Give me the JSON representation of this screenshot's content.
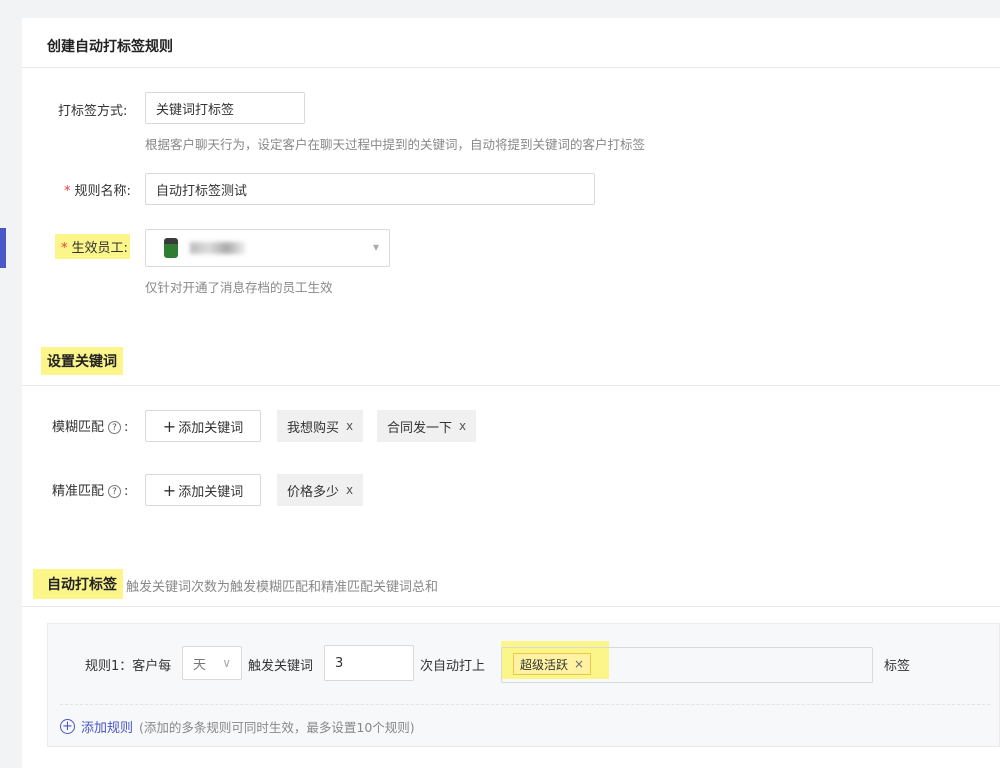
{
  "header": {
    "title": "创建自动打标签规则"
  },
  "form": {
    "method_label": "打标签方式:",
    "method_value": "关键词打标签",
    "method_hint": "根据客户聊天行为，设定客户在聊天过程中提到的关键词，自动将提到关键词的客户打标签",
    "rule_name_label": "规则名称:",
    "rule_name_value": "自动打标签测试",
    "employee_label": "生效员工:",
    "employee_hint": "仅针对开通了消息存档的员工生效",
    "required_mark": "*"
  },
  "keywords": {
    "section_title": "设置关键词",
    "fuzzy_label": "模糊匹配",
    "exact_label": "精准匹配",
    "colon": ":",
    "help_icon_char": "?",
    "add_button_label": "添加关键词",
    "plus_char": "+",
    "remove_char": "x",
    "fuzzy_chips": [
      "我想购买",
      "合同发一下"
    ],
    "exact_chips": [
      "价格多少"
    ]
  },
  "auto_tag": {
    "section_title": "自动打标签",
    "section_hint": "触发关键词次数为触发模糊匹配和精准匹配关键词总和",
    "rule_prefix": "规则1：客户每",
    "period_value": "天",
    "period_arrow": "∨",
    "trigger_label": "触发关键词",
    "count_value": "3",
    "auto_label": "次自动打上",
    "tag_chip": "超级活跃",
    "tag_remove": "×",
    "tag_suffix": "标签",
    "add_rule_icon": "+",
    "add_rule_label": "添加规则",
    "add_rule_hint": "(添加的多条规则可同时生效，最多设置10个规则)"
  },
  "colors": {
    "accent": "#4a55c8",
    "highlight": "#fbf58a",
    "required": "#e83a3a",
    "link": "#4a55c8"
  }
}
